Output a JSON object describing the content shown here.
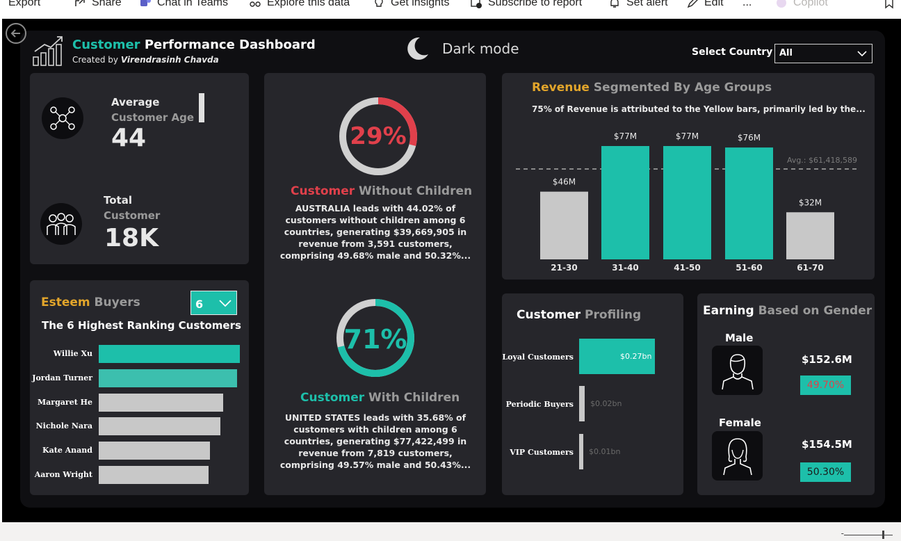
{
  "toolbar": {
    "items": [
      {
        "label": "Export",
        "icon": "export-icon"
      },
      {
        "label": "Share",
        "icon": "share-icon"
      },
      {
        "label": "Chat in Teams",
        "icon": "teams-icon"
      },
      {
        "label": "Explore this data",
        "icon": "explore-icon"
      },
      {
        "label": "Get insights",
        "icon": "lightbulb-icon"
      },
      {
        "label": "Subscribe to report",
        "icon": "subscribe-icon"
      },
      {
        "label": "Set alert",
        "icon": "bell-icon"
      },
      {
        "label": "Edit",
        "icon": "pencil-icon"
      },
      {
        "label": "...",
        "icon": "more-icon"
      },
      {
        "label": "Copilot",
        "icon": "copilot-icon"
      }
    ]
  },
  "header": {
    "title_accent": "Customer",
    "title_rest": " Performance Dashboard",
    "subtitle_prefix": "Created by ",
    "subtitle_author": "Virendrasinh Chavda",
    "dark_mode_label": "Dark mode",
    "select_label": "Select Country",
    "select_value": "All"
  },
  "kpis": {
    "age_label": "Average",
    "age_label2": "Customer Age",
    "age_value": "44",
    "total_label": "Total",
    "total_label2": "Customer",
    "total_value": "18K"
  },
  "without_children": {
    "percent": "29%",
    "fraction": 0.29,
    "title_accent": "Customer",
    "title_rest": " Without Children",
    "lines": [
      "AUSTRALIA leads with 44.02% of",
      "customers without children among 6",
      "countries, generating $39,669,905 in",
      "revenue from 3,591 customers,",
      "comprising 49.68% male and 50.32%..."
    ]
  },
  "with_children": {
    "percent": "71%",
    "fraction": 0.71,
    "title_accent": "Customer",
    "title_rest": " With Children",
    "lines": [
      "UNITED STATES leads with 35.68% of",
      "customers with children among 6",
      "countries, generating $77,422,499 in",
      "revenue from 7,819 customers,",
      "comprising 49.57% male and 50.43%..."
    ]
  },
  "esteem": {
    "title_accent": "Esteem",
    "title_rest": " Buyers",
    "dropdown_value": "6",
    "subtitle": "The 6 Highest Ranking Customers"
  },
  "revenue": {
    "title_accent": "Revenue",
    "title_rest": " Segmented By Age Groups",
    "subtitle": "75% of Revenue is attributed to the Yellow bars, primarily led by the..."
  },
  "profiling": {
    "title_accent": "Customer",
    "title_rest": " Profiling"
  },
  "gender": {
    "title_accent": "Earning",
    "title_rest": " Based on Gender",
    "male_label": "Male",
    "male_value": "$152.6M",
    "male_pct": "49.70%",
    "female_label": "Female",
    "female_value": "$154.5M",
    "female_pct": "50.30%"
  },
  "colors": {
    "teal": "#1dbfaa",
    "gray_bar": "#c8c8c8",
    "red": "#e0404b",
    "gold": "#e2a52b",
    "card": "#26262b"
  },
  "chart_data": [
    {
      "type": "bar",
      "id": "esteem-buyers",
      "orientation": "horizontal",
      "categories": [
        "Willie Xu",
        "Jordan Turner",
        "Margaret He",
        "Nichole Nara",
        "Kate Anand",
        "Aaron Wright"
      ],
      "values": [
        100,
        98,
        88,
        86,
        79,
        78
      ],
      "highlight": [
        true,
        true,
        false,
        false,
        false,
        false
      ]
    },
    {
      "type": "bar",
      "id": "revenue-age",
      "categories": [
        "21-30",
        "31-40",
        "41-50",
        "51-60",
        "61-70"
      ],
      "values": [
        46,
        77,
        77,
        76,
        32
      ],
      "data_labels": [
        "$46M",
        "$77M",
        "$77M",
        "$76M",
        "$32M"
      ],
      "highlight": [
        false,
        true,
        true,
        true,
        false
      ],
      "reference_line": {
        "value": 61.418589,
        "label": "Avg.: $61,418,589"
      },
      "ylim": [
        0,
        77
      ]
    },
    {
      "type": "bar",
      "id": "customer-profiling",
      "orientation": "horizontal",
      "categories": [
        "Loyal Customers",
        "Periodic Buyers",
        "VIP Customers"
      ],
      "values": [
        0.27,
        0.02,
        0.01
      ],
      "data_labels": [
        "$0.27bn",
        "$0.02bn",
        "$0.01bn"
      ]
    }
  ]
}
